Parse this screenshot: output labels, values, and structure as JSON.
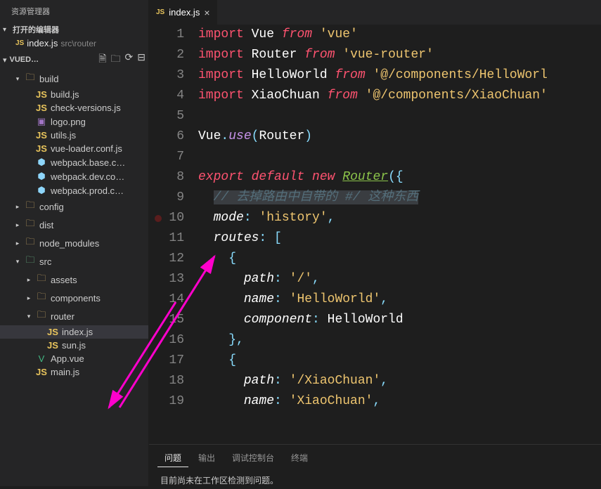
{
  "sidebar": {
    "title": "资源管理器",
    "openEditors": {
      "label": "打开的编辑器",
      "items": [
        {
          "icon": "JS",
          "name": "index.js",
          "path": "src\\router"
        }
      ]
    },
    "project": {
      "name": "VUED…",
      "actions": [
        "new-file",
        "new-folder",
        "refresh",
        "collapse"
      ]
    },
    "tree": [
      {
        "type": "folder",
        "name": "build",
        "indent": 1,
        "expanded": true,
        "iconClass": "icon-folder"
      },
      {
        "type": "file",
        "name": "build.js",
        "indent": 2,
        "iconClass": "icon-js",
        "icon": "JS"
      },
      {
        "type": "file",
        "name": "check-versions.js",
        "indent": 2,
        "iconClass": "icon-js",
        "icon": "JS"
      },
      {
        "type": "file",
        "name": "logo.png",
        "indent": 2,
        "iconClass": "icon-png",
        "icon": "▣"
      },
      {
        "type": "file",
        "name": "utils.js",
        "indent": 2,
        "iconClass": "icon-js",
        "icon": "JS"
      },
      {
        "type": "file",
        "name": "vue-loader.conf.js",
        "indent": 2,
        "iconClass": "icon-js",
        "icon": "JS"
      },
      {
        "type": "file",
        "name": "webpack.base.c…",
        "indent": 2,
        "iconClass": "icon-webpack",
        "icon": "⬢"
      },
      {
        "type": "file",
        "name": "webpack.dev.co…",
        "indent": 2,
        "iconClass": "icon-webpack",
        "icon": "⬢"
      },
      {
        "type": "file",
        "name": "webpack.prod.c…",
        "indent": 2,
        "iconClass": "icon-webpack",
        "icon": "⬢"
      },
      {
        "type": "folder",
        "name": "config",
        "indent": 1,
        "expanded": false,
        "iconClass": "icon-folder"
      },
      {
        "type": "folder",
        "name": "dist",
        "indent": 1,
        "expanded": false,
        "iconClass": "icon-folder-dist"
      },
      {
        "type": "folder",
        "name": "node_modules",
        "indent": 1,
        "expanded": false,
        "iconClass": "icon-folder"
      },
      {
        "type": "folder",
        "name": "src",
        "indent": 1,
        "expanded": true,
        "iconClass": "icon-folder-src"
      },
      {
        "type": "folder",
        "name": "assets",
        "indent": 2,
        "expanded": false,
        "iconClass": "icon-folder"
      },
      {
        "type": "folder",
        "name": "components",
        "indent": 2,
        "expanded": false,
        "iconClass": "icon-folder"
      },
      {
        "type": "folder",
        "name": "router",
        "indent": 2,
        "expanded": true,
        "iconClass": "icon-folder"
      },
      {
        "type": "file",
        "name": "index.js",
        "indent": 3,
        "iconClass": "icon-js",
        "icon": "JS",
        "selected": true
      },
      {
        "type": "file",
        "name": "sun.js",
        "indent": 3,
        "iconClass": "icon-js",
        "icon": "JS"
      },
      {
        "type": "file",
        "name": "App.vue",
        "indent": 2,
        "iconClass": "icon-vue",
        "icon": "V"
      },
      {
        "type": "file",
        "name": "main.js",
        "indent": 2,
        "iconClass": "icon-js",
        "icon": "JS"
      }
    ]
  },
  "tabs": [
    {
      "icon": "JS",
      "name": "index.js",
      "active": true
    }
  ],
  "code": {
    "startLine": 1,
    "breakpointLine": 10,
    "lines": [
      [
        {
          "t": "import ",
          "c": "kw-import"
        },
        {
          "t": "Vue ",
          "c": "ident"
        },
        {
          "t": "from ",
          "c": "kw-from"
        },
        {
          "t": "'vue'",
          "c": "str"
        }
      ],
      [
        {
          "t": "import ",
          "c": "kw-import"
        },
        {
          "t": "Router ",
          "c": "ident"
        },
        {
          "t": "from ",
          "c": "kw-from"
        },
        {
          "t": "'vue-router'",
          "c": "str"
        }
      ],
      [
        {
          "t": "import ",
          "c": "kw-import"
        },
        {
          "t": "HelloWorld ",
          "c": "ident"
        },
        {
          "t": "from ",
          "c": "kw-from"
        },
        {
          "t": "'@/components/HelloWorl",
          "c": "str"
        }
      ],
      [
        {
          "t": "import ",
          "c": "kw-import"
        },
        {
          "t": "XiaoChuan ",
          "c": "ident"
        },
        {
          "t": "from ",
          "c": "kw-from"
        },
        {
          "t": "'@/components/XiaoChuan'",
          "c": "str"
        }
      ],
      [],
      [
        {
          "t": "Vue",
          "c": "ident"
        },
        {
          "t": ".",
          "c": "punct"
        },
        {
          "t": "use",
          "c": "fn"
        },
        {
          "t": "(",
          "c": "punct"
        },
        {
          "t": "Router",
          "c": "ident"
        },
        {
          "t": ")",
          "c": "punct"
        }
      ],
      [],
      [
        {
          "t": "export ",
          "c": "kw-export"
        },
        {
          "t": "default ",
          "c": "kw-default"
        },
        {
          "t": "new ",
          "c": "kw-new"
        },
        {
          "t": "Router",
          "c": "router-link"
        },
        {
          "t": "({",
          "c": "punct"
        }
      ],
      [
        {
          "t": "  ",
          "c": ""
        },
        {
          "t": "// 去掉路由中自带的 #/ 这种东西",
          "c": "comment comment-hl"
        }
      ],
      [
        {
          "t": "  ",
          "c": ""
        },
        {
          "t": "mode",
          "c": "prop"
        },
        {
          "t": ": ",
          "c": "punct"
        },
        {
          "t": "'history'",
          "c": "str"
        },
        {
          "t": ",",
          "c": "punct"
        }
      ],
      [
        {
          "t": "  ",
          "c": ""
        },
        {
          "t": "routes",
          "c": "prop"
        },
        {
          "t": ": [",
          "c": "punct"
        }
      ],
      [
        {
          "t": "    ",
          "c": ""
        },
        {
          "t": "{",
          "c": "punct"
        }
      ],
      [
        {
          "t": "      ",
          "c": ""
        },
        {
          "t": "path",
          "c": "prop"
        },
        {
          "t": ": ",
          "c": "punct"
        },
        {
          "t": "'/'",
          "c": "str"
        },
        {
          "t": ",",
          "c": "punct"
        }
      ],
      [
        {
          "t": "      ",
          "c": ""
        },
        {
          "t": "name",
          "c": "prop"
        },
        {
          "t": ": ",
          "c": "punct"
        },
        {
          "t": "'HelloWorld'",
          "c": "str"
        },
        {
          "t": ",",
          "c": "punct"
        }
      ],
      [
        {
          "t": "      ",
          "c": ""
        },
        {
          "t": "component",
          "c": "prop"
        },
        {
          "t": ": ",
          "c": "punct"
        },
        {
          "t": "HelloWorld",
          "c": "ident"
        }
      ],
      [
        {
          "t": "    ",
          "c": ""
        },
        {
          "t": "},",
          "c": "punct"
        }
      ],
      [
        {
          "t": "    ",
          "c": ""
        },
        {
          "t": "{",
          "c": "punct"
        }
      ],
      [
        {
          "t": "      ",
          "c": ""
        },
        {
          "t": "path",
          "c": "prop"
        },
        {
          "t": ": ",
          "c": "punct"
        },
        {
          "t": "'/XiaoChuan'",
          "c": "str"
        },
        {
          "t": ",",
          "c": "punct"
        }
      ],
      [
        {
          "t": "      ",
          "c": ""
        },
        {
          "t": "name",
          "c": "prop"
        },
        {
          "t": ": ",
          "c": "punct"
        },
        {
          "t": "'XiaoChuan'",
          "c": "str"
        },
        {
          "t": ",",
          "c": "punct"
        }
      ]
    ]
  },
  "panel": {
    "tabs": [
      {
        "label": "问题",
        "active": true
      },
      {
        "label": "输出",
        "active": false
      },
      {
        "label": "调试控制台",
        "active": false
      },
      {
        "label": "终端",
        "active": false
      }
    ],
    "message": "目前尚未在工作区检测到问题。"
  }
}
